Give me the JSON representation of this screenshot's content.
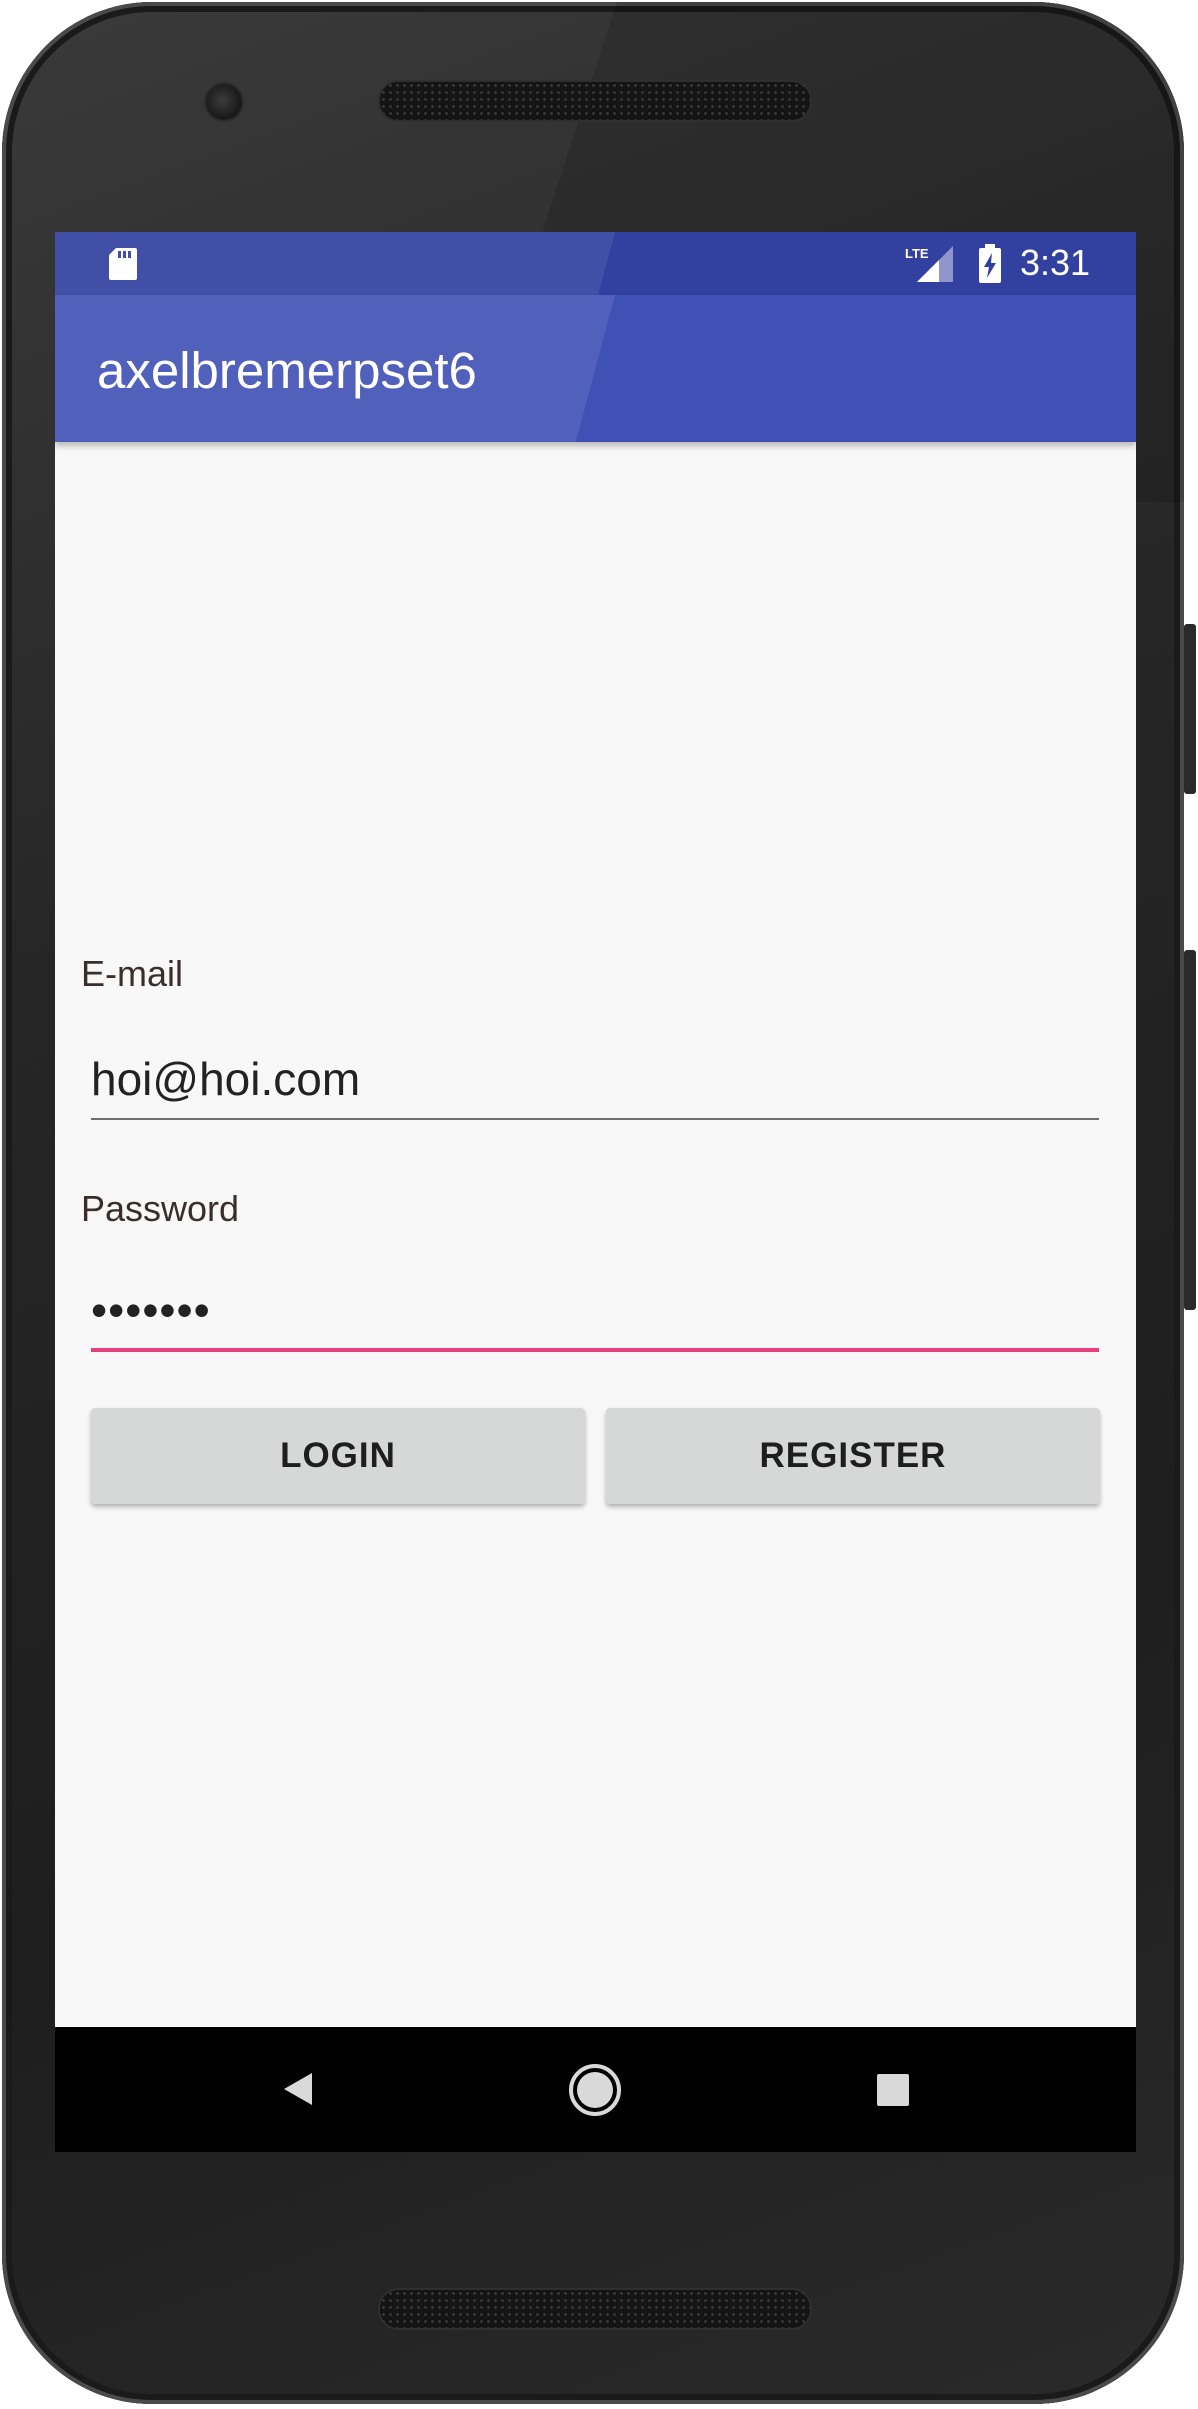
{
  "status_bar": {
    "time": "3:31",
    "network": "LTE",
    "icons": [
      "sd-card-icon",
      "lte-signal-icon",
      "battery-charging-icon"
    ]
  },
  "app_bar": {
    "title": "axelbremerpset6"
  },
  "form": {
    "email_label": "E-mail",
    "email_value": "hoi@hoi.com",
    "password_label": "Password",
    "password_value": "•••••••"
  },
  "buttons": {
    "login_label": "LOGIN",
    "register_label": "REGISTER"
  },
  "nav_bar": {
    "icons": [
      "back-icon",
      "home-icon",
      "recent-apps-icon"
    ]
  },
  "colors": {
    "status_bar": "#3241a0",
    "app_bar": "#3f51b5",
    "accent": "#e53f7d",
    "button": "#d6d7d7",
    "background": "#f8f8f8"
  }
}
